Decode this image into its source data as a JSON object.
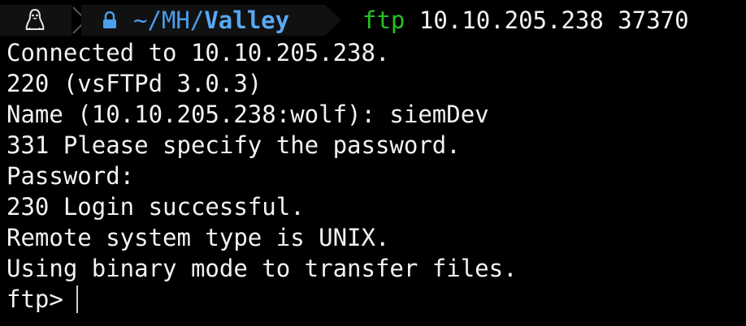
{
  "prompt": {
    "os_icon": "linux-tux-icon",
    "lock_icon": "lock-icon",
    "path_prefix": "~/MH/",
    "path_current": "Valley",
    "command": "ftp",
    "command_args": "10.10.205.238 37370"
  },
  "output_lines": [
    "Connected to 10.10.205.238.",
    "220 (vsFTPd 3.0.3)",
    "Name (10.10.205.238:wolf): siemDev",
    "331 Please specify the password.",
    "Password:",
    "230 Login successful.",
    "Remote system type is UNIX.",
    "Using binary mode to transfer files."
  ],
  "ftp_prompt": "ftp>",
  "colors": {
    "background": "#000000",
    "text": "#f2f2f2",
    "path": "#4a9eed",
    "command": "#26c126",
    "segment": "#111111"
  }
}
